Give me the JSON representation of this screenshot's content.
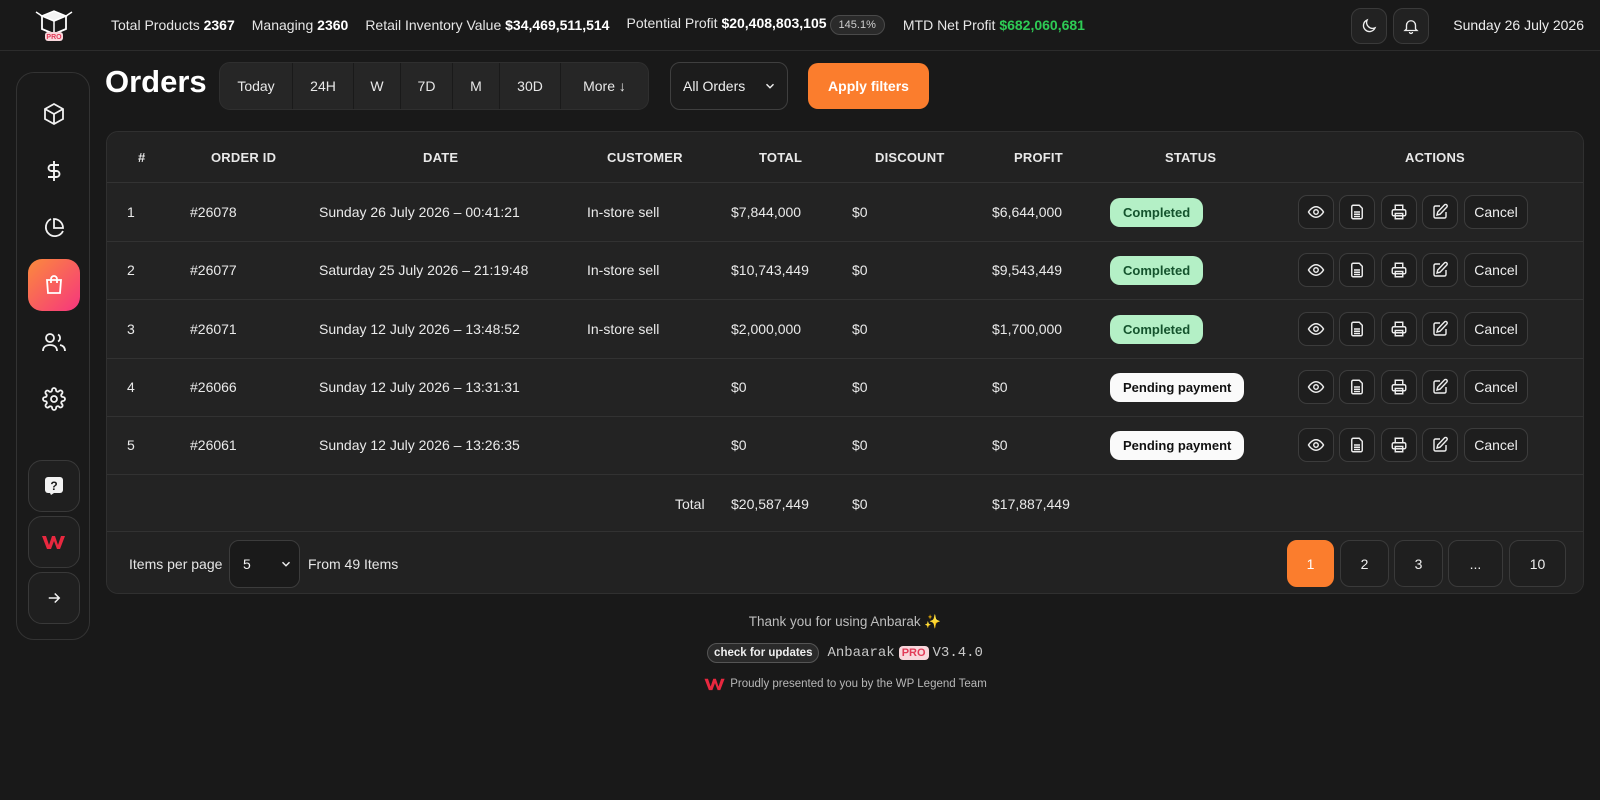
{
  "topbar": {
    "logo_badge": "PRO",
    "stats": [
      {
        "label": "Total Products",
        "value": "2367"
      },
      {
        "label": "Managing",
        "value": "2360"
      },
      {
        "label": "Retail Inventory Value",
        "value": "$34,469,511,514"
      },
      {
        "label": "Potential Profit",
        "value": "$20,408,803,105",
        "badge": "145.1%"
      },
      {
        "label": "MTD Net Profit",
        "value": "$682,060,681"
      }
    ],
    "date": "Sunday 26 July 2026",
    "icons": [
      "moon-icon",
      "bell-icon"
    ]
  },
  "sidebar": {
    "items": [
      "box-icon",
      "dollar-icon",
      "pie-chart-icon",
      "shopping-bag-icon",
      "users-icon",
      "settings-icon"
    ],
    "active": "shopping-bag-icon",
    "bottom": [
      "help-icon",
      "wp-legend-logo",
      "arrow-right-icon"
    ]
  },
  "page": {
    "title": "Orders",
    "ranges": [
      "Today",
      "24H",
      "W",
      "7D",
      "M",
      "30D",
      "More ↓"
    ],
    "filter_select": "All Orders",
    "apply_label": "Apply filters"
  },
  "table": {
    "headers": [
      "#",
      "ORDER ID",
      "DATE",
      "CUSTOMER",
      "TOTAL",
      "DISCOUNT",
      "PROFIT",
      "STATUS",
      "ACTIONS"
    ],
    "rows": [
      {
        "num": "1",
        "id": "#26078",
        "date": "Sunday 26 July 2026 – 00:41:21",
        "customer": "In-store sell",
        "total": "$7,844,000",
        "discount": "$0",
        "profit": "$6,644,000",
        "status": "Completed"
      },
      {
        "num": "2",
        "id": "#26077",
        "date": "Saturday 25 July 2026 – 21:19:48",
        "customer": "In-store sell",
        "total": "$10,743,449",
        "discount": "$0",
        "profit": "$9,543,449",
        "status": "Completed"
      },
      {
        "num": "3",
        "id": "#26071",
        "date": "Sunday 12 July 2026 – 13:48:52",
        "customer": "In-store sell",
        "total": "$2,000,000",
        "discount": "$0",
        "profit": "$1,700,000",
        "status": "Completed"
      },
      {
        "num": "4",
        "id": "#26066",
        "date": "Sunday 12 July 2026 – 13:31:31",
        "customer": "",
        "total": "$0",
        "discount": "$0",
        "profit": "$0",
        "status": "Pending payment"
      },
      {
        "num": "5",
        "id": "#26061",
        "date": "Sunday 12 July 2026 – 13:26:35",
        "customer": "",
        "total": "$0",
        "discount": "$0",
        "profit": "$0",
        "status": "Pending payment"
      }
    ],
    "cancel_label": "Cancel",
    "totals": {
      "label": "Total",
      "total": "$20,587,449",
      "discount": "$0",
      "profit": "$17,887,449"
    },
    "status_colors": {
      "Completed": "#b4f0c6",
      "Pending payment": "#fafafa"
    }
  },
  "pagination": {
    "items_per_page_label": "Items per page",
    "per_page": "5",
    "from_text": "From 49 Items",
    "pages": [
      "1",
      "2",
      "3",
      "...",
      "10"
    ],
    "current": "1"
  },
  "footer": {
    "thanks": "Thank you for using Anbarak ✨",
    "update_label": "check for updates",
    "app_name": "Anbaarak",
    "pro": "PRO",
    "version": "V3.4.0",
    "credit": "Proudly presented to you by the WP Legend Team"
  },
  "colors": {
    "accent": "#fb7d2d",
    "profit_green": "#2ecc55",
    "background": "#191919"
  }
}
